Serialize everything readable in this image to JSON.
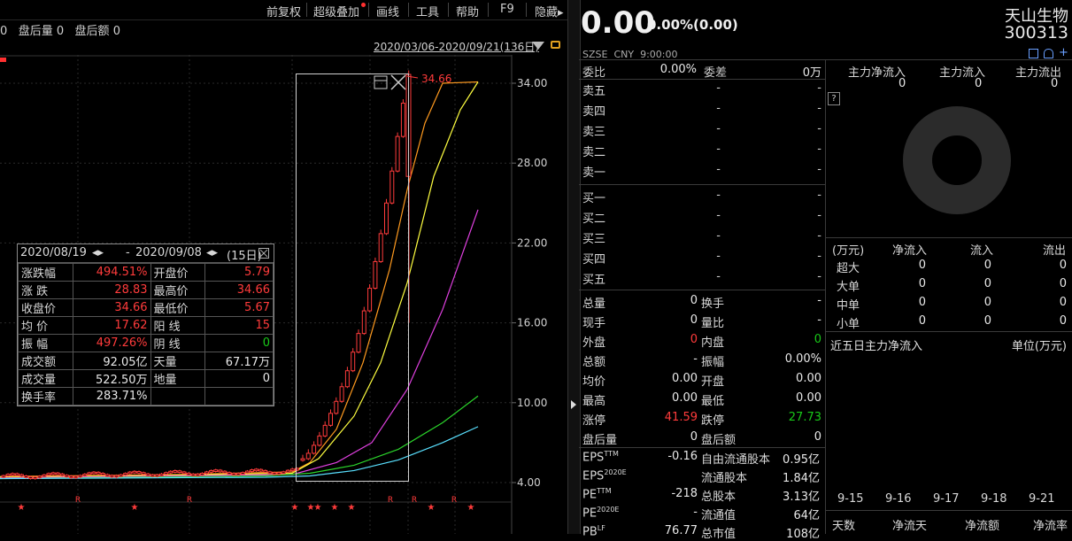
{
  "toolbar": {
    "items": [
      "前复权",
      "超级叠加",
      "画线",
      "工具",
      "帮助",
      "F9",
      "隐藏▸"
    ]
  },
  "subline": {
    "pre": "0",
    "after_vol_label": "盘后量",
    "after_vol": "0",
    "after_amt_label": "盘后额",
    "after_amt": "0"
  },
  "date_range": "2020/03/06-2020/09/21(136日)",
  "chart_data": {
    "type": "candlestick",
    "y_ticks": [
      "34.00",
      "28.00",
      "22.00",
      "16.00",
      "10.00",
      "4.00"
    ],
    "ylim": [
      2.9,
      36.6
    ],
    "peak_label": "34.66",
    "markers": [
      {
        "sym": "★",
        "x": 0
      },
      {
        "sym": "R",
        "x": 1
      },
      {
        "sym": "★",
        "x": 2
      },
      {
        "sym": "R",
        "x": 3
      },
      {
        "sym": "★",
        "x": 4
      },
      {
        "sym": "★",
        "x": 5
      },
      {
        "sym": "★",
        "x": 6
      },
      {
        "sym": "★",
        "x": 7
      },
      {
        "sym": "★",
        "x": 8
      },
      {
        "sym": "R",
        "x": 9
      },
      {
        "sym": "R",
        "x": 10
      },
      {
        "sym": "★",
        "x": 11
      },
      {
        "sym": "R",
        "x": 12
      },
      {
        "sym": "★",
        "x": 13
      }
    ]
  },
  "popup": {
    "range_start": "2020/08/19",
    "range_sep": "-",
    "range_end": "2020/09/08",
    "days": "(15日)",
    "rows": [
      [
        "涨跌幅",
        "494.51%",
        "开盘价",
        "5.79"
      ],
      [
        "涨  跌",
        "28.83",
        "最高价",
        "34.66"
      ],
      [
        "收盘价",
        "34.66",
        "最低价",
        "5.67"
      ],
      [
        "均  价",
        "17.62",
        "阳  线",
        "15"
      ],
      [
        "振  幅",
        "497.26%",
        "阴  线",
        "0"
      ],
      [
        "成交额",
        "92.05亿",
        "天量",
        "67.17万"
      ],
      [
        "成交量",
        "522.50万",
        "地量",
        "0"
      ],
      [
        "换手率",
        "283.71%",
        "",
        ""
      ]
    ]
  },
  "quote": {
    "price": "0.00",
    "change": "0.00%(0.00)",
    "name": "天山生物",
    "code": "300313",
    "exchange": "SZSE",
    "currency": "CNY",
    "time": "9:00:00",
    "weibi_label": "委比",
    "weibi": "0.00%",
    "weicha_label": "委差",
    "weicha": "0万",
    "sell": [
      [
        "卖五",
        "-",
        "-"
      ],
      [
        "卖四",
        "-",
        "-"
      ],
      [
        "卖三",
        "-",
        "-"
      ],
      [
        "卖二",
        "-",
        "-"
      ],
      [
        "卖一",
        "-",
        "-"
      ]
    ],
    "buy": [
      [
        "买一",
        "-",
        "-"
      ],
      [
        "买二",
        "-",
        "-"
      ],
      [
        "买三",
        "-",
        "-"
      ],
      [
        "买四",
        "-",
        "-"
      ],
      [
        "买五",
        "-",
        "-"
      ]
    ],
    "stats": [
      [
        "总量",
        "0",
        "换手",
        "-"
      ],
      [
        "现手",
        "0",
        "量比",
        "-"
      ],
      [
        "外盘",
        "0",
        "内盘",
        "0"
      ],
      [
        "总额",
        "-",
        "振幅",
        "0.00%"
      ],
      [
        "均价",
        "0.00",
        "开盘",
        "0.00"
      ],
      [
        "最高",
        "0.00",
        "最低",
        "0.00"
      ],
      [
        "涨停",
        "41.59",
        "跌停",
        "27.73"
      ],
      [
        "盘后量",
        "0",
        "盘后额",
        "0"
      ]
    ],
    "fin": [
      [
        "EPS",
        "TTM",
        "-0.16",
        "自由流通股本",
        "0.95亿"
      ],
      [
        "EPS",
        "2020E",
        "",
        "流通股本",
        "1.84亿"
      ],
      [
        "PE",
        "TTM",
        "-218",
        "总股本",
        "3.13亿"
      ],
      [
        "PE",
        "2020E",
        "-",
        "流通值",
        "64亿"
      ],
      [
        "PB",
        "LF",
        "76.77",
        "总市值",
        "108亿"
      ]
    ]
  },
  "flow": {
    "head": [
      "主力净流入",
      "主力流入",
      "主力流出"
    ],
    "vals": [
      "0",
      "0",
      "0"
    ],
    "help": "?",
    "table_head": [
      "(万元)",
      "净流入",
      "流入",
      "流出"
    ],
    "table_rows": [
      [
        "超大",
        "0",
        "0",
        "0"
      ],
      [
        "大单",
        "0",
        "0",
        "0"
      ],
      [
        "中单",
        "0",
        "0",
        "0"
      ],
      [
        "小单",
        "0",
        "0",
        "0"
      ]
    ],
    "five_day_title": "近五日主力净流入",
    "five_day_unit": "单位(万元)",
    "days": [
      "9-15",
      "9-16",
      "9-17",
      "9-18",
      "9-21"
    ],
    "bottom_head": [
      "天数",
      "净流天",
      "净流额",
      "净流率"
    ]
  },
  "colors": {
    "up": "#ff3b3b",
    "down": "#19c919",
    "ma1": "#ff9a1f",
    "ma2": "#ffff40",
    "ma3": "#e040e0",
    "ma4": "#2bd42b",
    "ma5": "#59e0ff"
  }
}
